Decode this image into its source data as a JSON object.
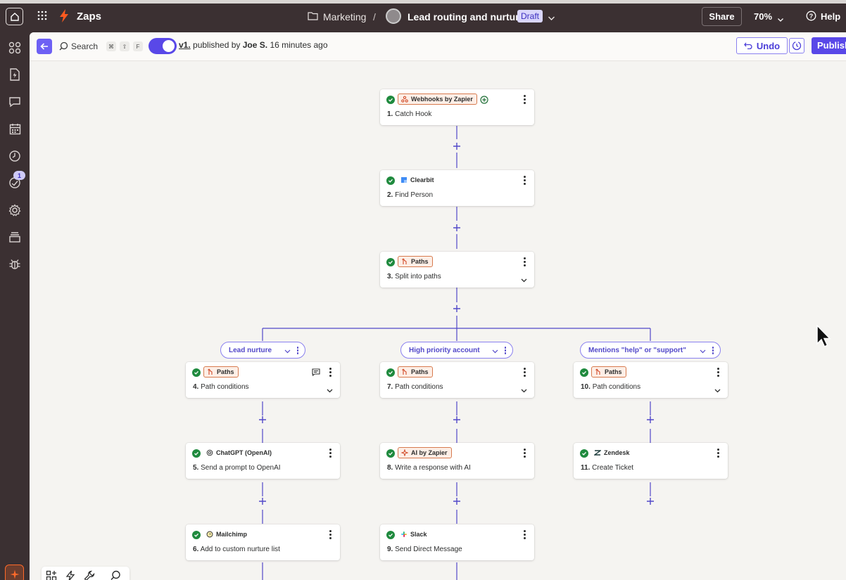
{
  "topbar": {
    "app_name": "Zaps",
    "folder": "Marketing",
    "separator": "/",
    "zap_title": "Lead routing and nurture",
    "status_badge": "Draft",
    "share_label": "Share",
    "zoom_label": "70%",
    "help_label": "Help"
  },
  "rail": {
    "notification_count": "1",
    "items": [
      "apps-icon",
      "zap-file-icon",
      "chat-icon",
      "calendar-icon",
      "history-icon",
      "runs-icon",
      "settings-icon",
      "versions-icon",
      "bug-icon"
    ]
  },
  "subbar": {
    "search_label": "Search",
    "shortcut_keys": [
      "⌘",
      "⇧",
      "F"
    ],
    "version": "v1.",
    "published_by_text": " published by ",
    "author": "Joe S.",
    "time_ago": " 16 minutes ago",
    "undo_label": "Undo",
    "publish_label": "Publish"
  },
  "steps": [
    {
      "num": "1.",
      "title": "Catch Hook",
      "app": "Webhooks by Zapier"
    },
    {
      "num": "2.",
      "title": "Find Person",
      "app": "Clearbit"
    },
    {
      "num": "3.",
      "title": "Split into paths",
      "app": "Paths"
    },
    {
      "num": "4.",
      "title": "Path conditions",
      "app": "Paths"
    },
    {
      "num": "5.",
      "title": "Send a prompt to OpenAI",
      "app": "ChatGPT (OpenAI)"
    },
    {
      "num": "6.",
      "title": "Add to custom nurture list",
      "app": "Mailchimp"
    },
    {
      "num": "7.",
      "title": "Path conditions",
      "app": "Paths"
    },
    {
      "num": "8.",
      "title": "Write a response with AI",
      "app": "AI by Zapier"
    },
    {
      "num": "9.",
      "title": "Send Direct Message",
      "app": "Slack"
    },
    {
      "num": "10.",
      "title": "Path conditions",
      "app": "Paths"
    },
    {
      "num": "11.",
      "title": "Create Ticket",
      "app": "Zendesk"
    }
  ],
  "paths": [
    {
      "label": "Lead nurture"
    },
    {
      "label": "High priority account"
    },
    {
      "label": "Mentions \"help\" or \"support\""
    }
  ],
  "colors": {
    "accent": "#5948e8",
    "success": "#1f8a3e",
    "topbar_bg": "#3b3032",
    "canvas_bg": "#f5f4f1"
  }
}
